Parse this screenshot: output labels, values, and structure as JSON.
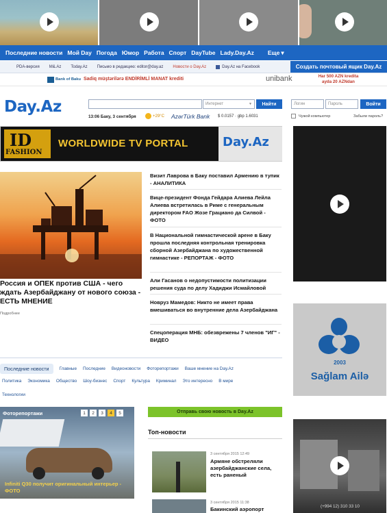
{
  "video_strip": {
    "count": 4
  },
  "top_nav": {
    "items": [
      "Последние новости",
      "Мой Day",
      "Погода",
      "Юмор",
      "Работа",
      "Спорт",
      "DayTube",
      "Lady.Day.Az",
      "Еще"
    ],
    "more_arrow": "▾"
  },
  "sub_nav": {
    "items": [
      "PDA-версия",
      "M&.Az",
      "Today.Az",
      "Письмо в редакцию: editor@day.az",
      "Новости о Day.Az",
      "Day.Az на Facebook"
    ],
    "mail_button": "Создать почтовый ящик Day.Az"
  },
  "bank_banner": {
    "left_brand": "Bank of Baku",
    "headline": "Sadiq müştərilərə ENDİRİMLİ MANAT krediti",
    "right_brand": "unibank",
    "offer_line1": "Har 500 AZN kredita",
    "offer_line2": "ayda 20 AZNdan"
  },
  "header": {
    "logo": "Day.Az",
    "search_placeholder": "",
    "search_scope": "Интернет",
    "search_button": "Найти",
    "date_line": "13:06  Баку, 3 сентября",
    "temperature": "+29°C",
    "bank_label": "AzərTürk Bank",
    "rates": "$ 0.0157 · gbp 1.6031",
    "login_placeholder": "Логин",
    "password_placeholder": "Пароль",
    "login_button": "Войти",
    "foreign_computer": "Чужой компьютер",
    "forgot_password": "Забыли пароль?"
  },
  "banner": {
    "id_text": "ID",
    "fashion_text": "FASHION",
    "slogan": "WORLDWIDE TV PORTAL",
    "brand": "Day.Az"
  },
  "main_story": {
    "headline": "Россия и ОПЕК против США - чего ждать Азербайджану от нового союза - ЕСТЬ МНЕНИЕ",
    "more": "Подробнее"
  },
  "news_list": [
    "Визит Лаврова в Баку поставил Армению в тупик - АНАЛИТИКА",
    "Вице-президент Фонда Гейдара Алиева Лейла Алиева встретилась в Риме с генеральным директором FAO Жозе Грациано да Силвой - ФОТО",
    "В Национальной гимнастической арене в Баку прошла последняя контрольная тренировка сборной Азербайджана по художественной гимнастике - РЕПОРТАЖ - ФОТО",
    "Али Гасанов о недопустимости политизации решения суда по делу Хадиджи Исмайловой",
    "Новруз Мамедов: Никто не имеет права вмешиваться во внутренние дела Азербайджана",
    "Спецоперация МНБ: обезврежены 7 членов \"ИГ\" - ВИДЕО"
  ],
  "category_tabs": {
    "row1": [
      "Последние новости",
      "Главные",
      "Последние",
      "Видеоновости",
      "Фоторепортажи",
      "Ваше мнение на Day.Az"
    ],
    "row2": [
      "Политика",
      "Экономика",
      "Общество",
      "Шоу-бизнес",
      "Спорт",
      "Культура",
      "Криминал",
      "Это интересно",
      "В мире"
    ],
    "row3": [
      "Технологии"
    ]
  },
  "photo_report": {
    "title": "Фоторепортажи",
    "pages": [
      "1",
      "2",
      "3",
      "4",
      "5"
    ],
    "active_page": "4",
    "caption": "Infiniti Q30 получит оригинальный интерьер - ФОТО"
  },
  "send_news": {
    "label": "Отправь свою новость в Day.Az"
  },
  "top_news": {
    "title": "Топ-новости",
    "items": [
      {
        "time": "3 сентября 2015 12:49",
        "headline": "Армяне обстреляли азербайджанские села, есть раненый"
      },
      {
        "time": "3 сентября 2015 11:38",
        "headline": "Бакинский аэропорт"
      }
    ]
  },
  "sidebar": {
    "saglam_year": "2003",
    "saglam_name": "Sağlam Ailə",
    "phone": "(+994 12) 310 33 10"
  },
  "colors": {
    "brand_blue": "#1d66c2",
    "accent_green": "#7cc32a",
    "red": "#c0392b"
  }
}
